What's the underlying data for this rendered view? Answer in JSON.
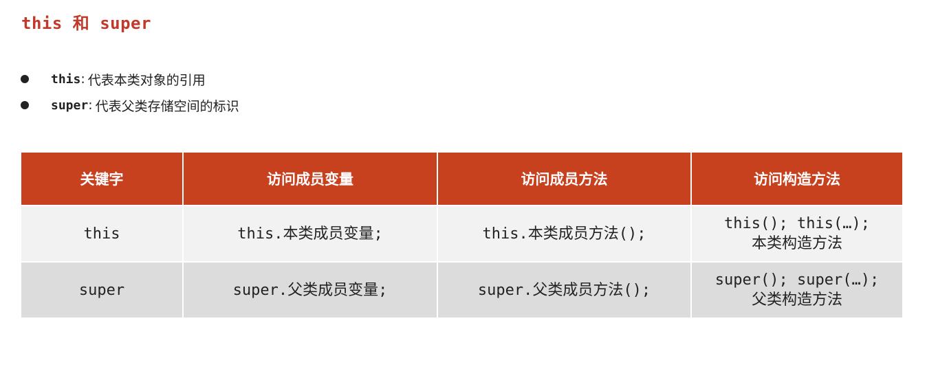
{
  "title": "this 和 super",
  "bullets": [
    {
      "keyword": "this",
      "sep": ":",
      "text": "代表本类对象的引用"
    },
    {
      "keyword": "super",
      "sep": ":",
      "text": "代表父类存储空间的标识"
    }
  ],
  "table": {
    "headers": [
      "关键字",
      "访问成员变量",
      "访问成员方法",
      "访问构造方法"
    ],
    "rows": [
      {
        "keyword": "this",
        "member_var": "this.本类成员变量;",
        "member_method": "this.本类成员方法();",
        "constructor_line1": "this(); this(…);",
        "constructor_line2": "本类构造方法"
      },
      {
        "keyword": "super",
        "member_var": "super.父类成员变量;",
        "member_method": "super.父类成员方法();",
        "constructor_line1": "super(); super(…);",
        "constructor_line2": "父类构造方法"
      }
    ]
  },
  "colors": {
    "accent": "#c0392b",
    "header_bg": "#c8411f",
    "row_light": "#f2f2f2",
    "row_dark": "#dcdcdc"
  }
}
